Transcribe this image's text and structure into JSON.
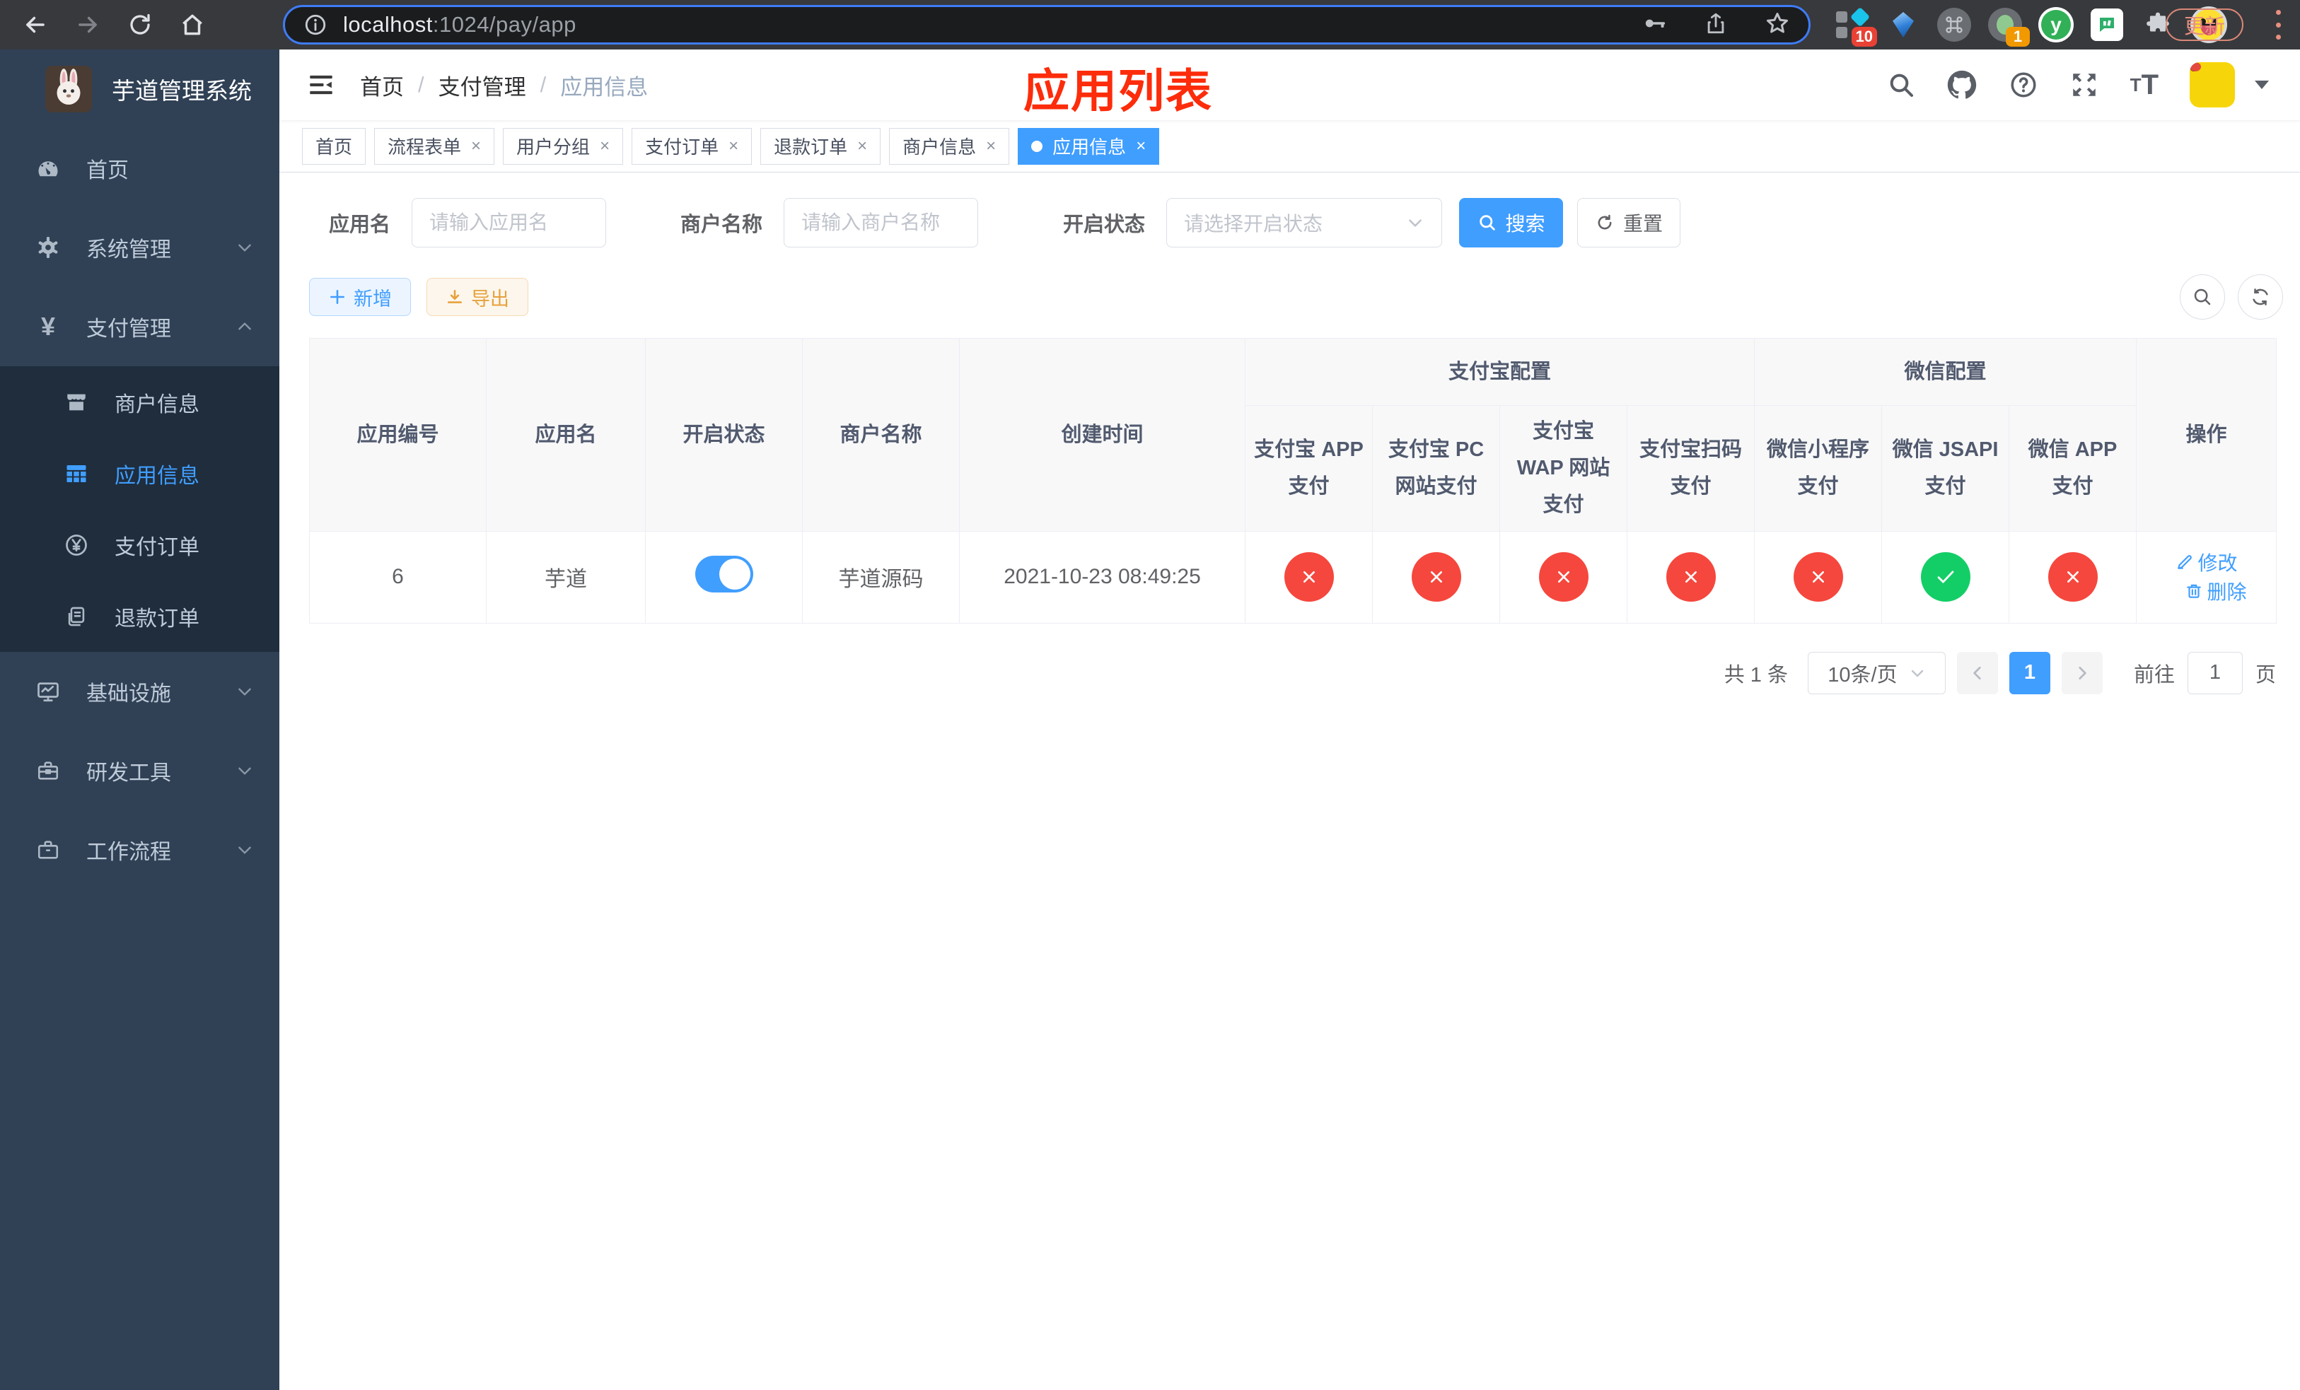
{
  "browser": {
    "url_host": "localhost",
    "url_path": ":1024/pay/app",
    "update_button": "更新",
    "extension_badge_1": "10",
    "extension_badge_2": "1",
    "yuque_letter": "y"
  },
  "sidebar": {
    "title": "芋道管理系统",
    "items": [
      {
        "label": "首页",
        "icon": "dashboard-icon"
      },
      {
        "label": "系统管理",
        "icon": "gear-icon",
        "chevron": "down"
      },
      {
        "label": "支付管理",
        "icon": "yen-icon",
        "chevron": "up",
        "children": [
          {
            "label": "商户信息",
            "icon": "shop-icon"
          },
          {
            "label": "应用信息",
            "icon": "grid-icon",
            "active": true
          },
          {
            "label": "支付订单",
            "icon": "yen-circle-icon"
          },
          {
            "label": "退款订单",
            "icon": "document-icon"
          }
        ]
      },
      {
        "label": "基础设施",
        "icon": "monitor-icon",
        "chevron": "down"
      },
      {
        "label": "研发工具",
        "icon": "toolbox-icon",
        "chevron": "down"
      },
      {
        "label": "工作流程",
        "icon": "briefcase-icon",
        "chevron": "down"
      }
    ]
  },
  "navbar": {
    "breadcrumb": [
      "首页",
      "支付管理",
      "应用信息"
    ],
    "overlay_title": "应用列表"
  },
  "tabs": {
    "items": [
      {
        "label": "首页",
        "closable": false,
        "active": false
      },
      {
        "label": "流程表单",
        "closable": true,
        "active": false
      },
      {
        "label": "用户分组",
        "closable": true,
        "active": false
      },
      {
        "label": "支付订单",
        "closable": true,
        "active": false
      },
      {
        "label": "退款订单",
        "closable": true,
        "active": false
      },
      {
        "label": "商户信息",
        "closable": true,
        "active": false
      },
      {
        "label": "应用信息",
        "closable": true,
        "active": true
      }
    ]
  },
  "filters": {
    "app_name_label": "应用名",
    "app_name_placeholder": "请输入应用名",
    "merchant_label": "商户名称",
    "merchant_placeholder": "请输入商户名称",
    "status_label": "开启状态",
    "status_placeholder": "请选择开启状态",
    "search_button": "搜索",
    "reset_button": "重置"
  },
  "toolbar": {
    "add_button": "新增",
    "export_button": "导出"
  },
  "table": {
    "simple_headers": [
      "应用编号",
      "应用名",
      "开启状态",
      "商户名称",
      "创建时间"
    ],
    "groups": [
      {
        "label": "支付宝配置",
        "children": [
          "支付宝 APP 支付",
          "支付宝 PC 网站支付",
          "支付宝 WAP 网站支付",
          "支付宝扫码支付"
        ]
      },
      {
        "label": "微信配置",
        "children": [
          "微信小程序支付",
          "微信 JSAPI 支付",
          "微信 APP 支付"
        ]
      }
    ],
    "actions_header": "操作",
    "rows": [
      {
        "id": "6",
        "name": "芋道",
        "enabled": true,
        "merchant": "芋道源码",
        "created_at": "2021-10-23 08:49:25",
        "pay_status": [
          false,
          false,
          false,
          false,
          false,
          true,
          false
        ],
        "edit_label": "修改",
        "delete_label": "删除"
      }
    ]
  },
  "pagination": {
    "total": "共 1 条",
    "page_size": "10条/页",
    "current_page": "1",
    "goto_label": "前往",
    "goto_value": "1",
    "page_unit": "页"
  },
  "colors": {
    "primary": "#409eff",
    "success": "#13ce66",
    "danger": "#f5473d",
    "warning": "#e6a23c",
    "sidebar_bg": "#304156",
    "submenu_bg": "#1f2d3d",
    "overlay_title_color": "#fd2c0b"
  }
}
